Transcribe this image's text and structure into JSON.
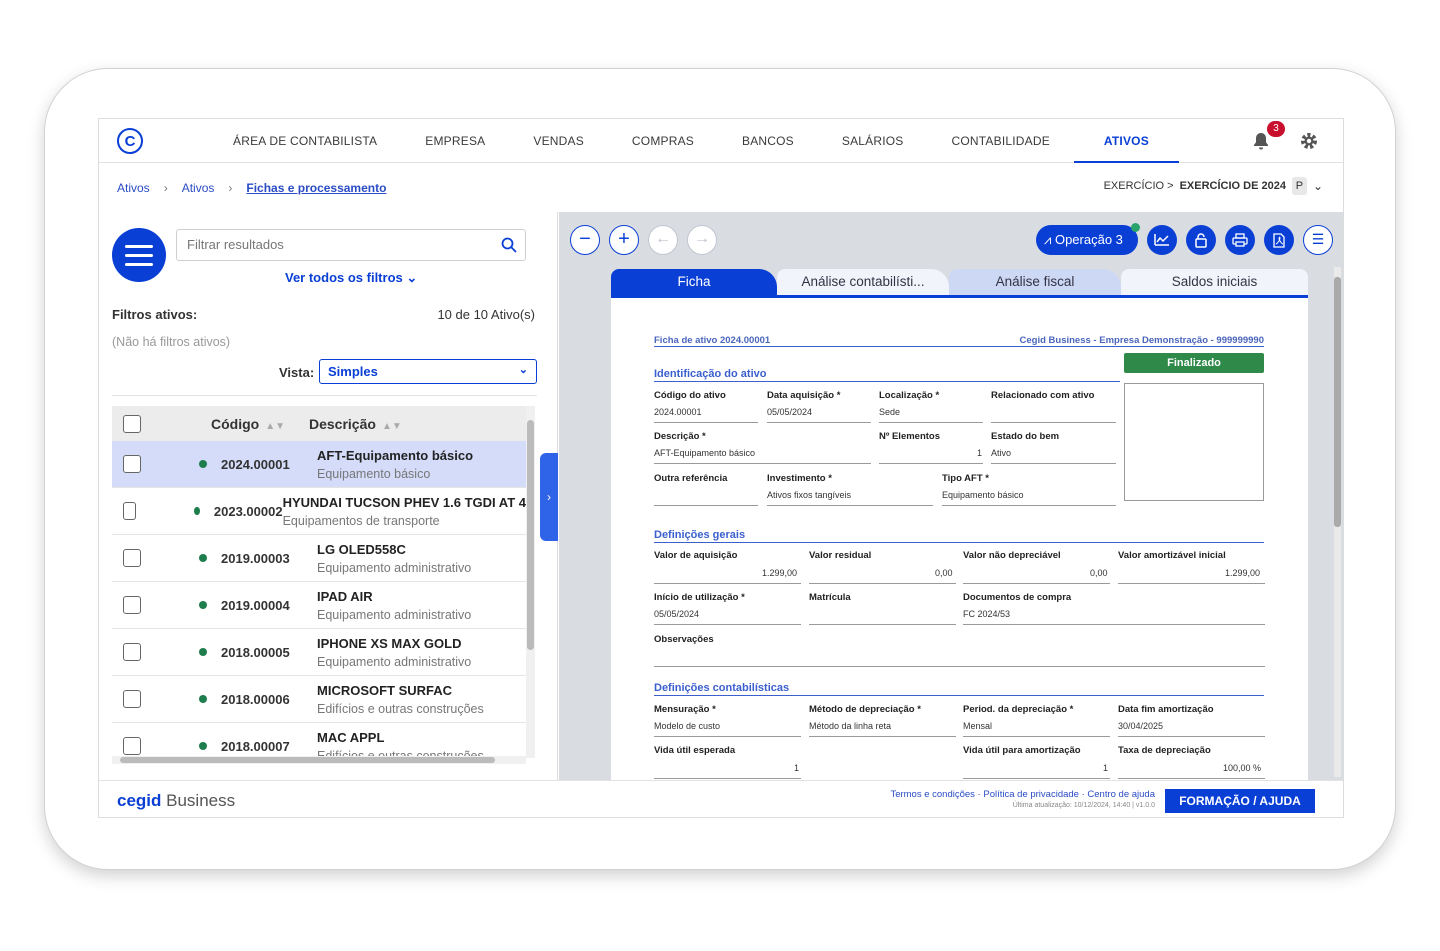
{
  "nav": {
    "logo": "C",
    "items": [
      "ÁREA DE CONTABILISTA",
      "EMPRESA",
      "VENDAS",
      "COMPRAS",
      "BANCOS",
      "SALÁRIOS",
      "CONTABILIDADE",
      "ATIVOS"
    ],
    "active": "ATIVOS",
    "notifications": "3"
  },
  "breadcrumb": {
    "items": [
      "Ativos",
      "Ativos",
      "Fichas e processamento"
    ]
  },
  "exercicio": {
    "prefix": "EXERCÍCIO >",
    "value": "EXERCÍCIO DE 2024",
    "badge": "P"
  },
  "left": {
    "search_placeholder": "Filtrar resultados",
    "ver_todos": "Ver todos os filtros",
    "filtros_label": "Filtros ativos:",
    "count": "10 de 10 Ativo(s)",
    "no_filters": "(Não há filtros ativos)",
    "vista_label": "Vista:",
    "vista_value": "Simples",
    "columns": {
      "codigo": "Código",
      "descricao": "Descrição"
    },
    "rows": [
      {
        "code": "2024.00001",
        "title": "AFT-Equipamento básico",
        "sub": "Equipamento básico"
      },
      {
        "code": "2023.00002",
        "title": "HYUNDAI TUCSON PHEV 1.6 TGDI AT 4",
        "sub": "Equipamentos de transporte"
      },
      {
        "code": "2019.00003",
        "title": "LG OLED558C",
        "sub": "Equipamento administrativo"
      },
      {
        "code": "2019.00004",
        "title": "IPAD AIR",
        "sub": "Equipamento administrativo"
      },
      {
        "code": "2018.00005",
        "title": "IPHONE XS MAX GOLD",
        "sub": "Equipamento administrativo"
      },
      {
        "code": "2018.00006",
        "title": "MICROSOFT SURFAC",
        "sub": "Edifícios e outras construções"
      },
      {
        "code": "2018.00007",
        "title": "MAC APPL",
        "sub": "Edifícios e outras construções"
      }
    ]
  },
  "toolbar": {
    "operacao": "Operação 3"
  },
  "tabs": [
    "Ficha",
    "Análise contabilísti...",
    "Análise fiscal",
    "Saldos iniciais"
  ],
  "doc": {
    "header_left": "Ficha de ativo 2024.00001",
    "header_right": "Cegid Business - Empresa Demonstração - 999999990",
    "status": "Finalizado",
    "sec1": "Identificação do ativo",
    "codigo_lbl": "Código do ativo",
    "codigo_val": "2024.00001",
    "data_lbl": "Data aquisição *",
    "data_val": "05/05/2024",
    "loc_lbl": "Localização *",
    "loc_val": "Sede",
    "rel_lbl": "Relacionado com ativo",
    "desc_lbl": "Descrição *",
    "desc_val": "AFT-Equipamento básico",
    "nel_lbl": "Nº Elementos",
    "nel_val": "1",
    "estado_lbl": "Estado do bem",
    "estado_val": "Ativo",
    "outra_lbl": "Outra referência",
    "inv_lbl": "Investimento *",
    "inv_val": "Ativos fixos tangíveis",
    "tipo_lbl": "Tipo AFT *",
    "tipo_val": "Equipamento básico",
    "sec2": "Definições gerais",
    "vaq_lbl": "Valor de aquisição",
    "vaq_val": "1.299,00",
    "vres_lbl": "Valor residual",
    "vres_val": "0,00",
    "vnd_lbl": "Valor não depreciável",
    "vnd_val": "0,00",
    "vai_lbl": "Valor amortizável inicial",
    "vai_val": "1.299,00",
    "ini_lbl": "Início de utilização *",
    "ini_val": "05/05/2024",
    "mat_lbl": "Matrícula",
    "docs_lbl": "Documentos de compra",
    "docs_val": "FC 2024/53",
    "obs_lbl": "Observações",
    "sec3": "Definições contabilísticas",
    "mens_lbl": "Mensuração *",
    "mens_val": "Modelo de custo",
    "met_lbl": "Método de depreciação *",
    "met_val": "Método da linha reta",
    "per_lbl": "Period. da depreciação *",
    "per_val": "Mensal",
    "dfa_lbl": "Data fim amortização",
    "dfa_val": "30/04/2025",
    "vue_lbl": "Vida útil esperada",
    "vue_val": "1",
    "vua_lbl": "Vida útil para amortização",
    "vua_val": "1",
    "tx_lbl": "Taxa de depreciação",
    "tx_val": "100,00 %"
  },
  "footer": {
    "brand_a": "cegid",
    "brand_b": "Business",
    "links": "Termos e condições · Política de privacidade · Centro de ajuda",
    "updated": "Última atualização: 10/12/2024, 14:40 | v1.0.0",
    "help": "FORMAÇÃO / AJUDA"
  },
  "colors": {
    "primary": "#0a3fd6",
    "status_green": "#2f8a4a",
    "badge_red": "#c8102e"
  }
}
